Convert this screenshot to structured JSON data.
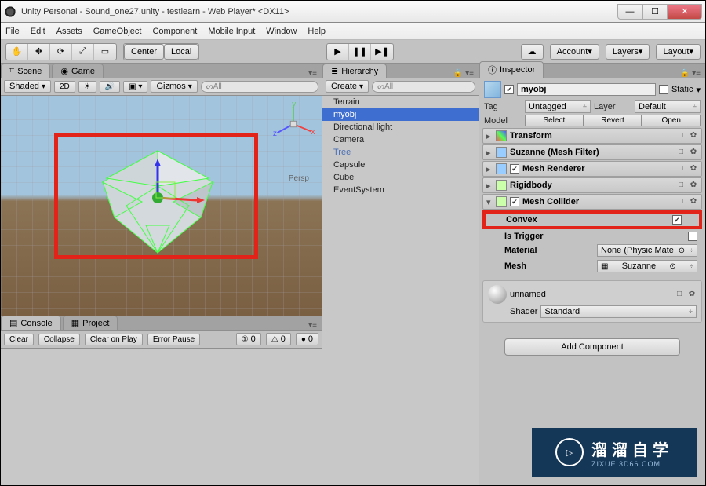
{
  "window": {
    "title": "Unity Personal - Sound_one27.unity - testlearn - Web Player* <DX11>"
  },
  "menus": [
    "File",
    "Edit",
    "Assets",
    "GameObject",
    "Component",
    "Mobile Input",
    "Window",
    "Help"
  ],
  "toolbar": {
    "center": "Center",
    "local": "Local",
    "account": "Account",
    "layers": "Layers",
    "layout": "Layout"
  },
  "scene": {
    "tab_scene": "Scene",
    "tab_game": "Game",
    "shading": "Shaded",
    "mode2d": "2D",
    "gizmos": "Gizmos",
    "search_placeholder": "All",
    "persp": "Persp"
  },
  "console": {
    "tab_console": "Console",
    "tab_project": "Project",
    "clear": "Clear",
    "collapse": "Collapse",
    "clear_on_play": "Clear on Play",
    "error_pause": "Error Pause",
    "count0": "0",
    "count1": "0",
    "count2": "0"
  },
  "hierarchy": {
    "tab": "Hierarchy",
    "create": "Create",
    "search_placeholder": "All",
    "items": [
      {
        "label": "Terrain",
        "blue": false,
        "sel": false
      },
      {
        "label": "myobj",
        "blue": false,
        "sel": true
      },
      {
        "label": "Directional light",
        "blue": false,
        "sel": false
      },
      {
        "label": "Camera",
        "blue": false,
        "sel": false
      },
      {
        "label": "Tree",
        "blue": true,
        "sel": false
      },
      {
        "label": "Capsule",
        "blue": false,
        "sel": false
      },
      {
        "label": "Cube",
        "blue": false,
        "sel": false
      },
      {
        "label": "EventSystem",
        "blue": false,
        "sel": false
      }
    ]
  },
  "inspector": {
    "tab": "Inspector",
    "obj_name": "myobj",
    "static": "Static",
    "tag_label": "Tag",
    "tag_value": "Untagged",
    "layer_label": "Layer",
    "layer_value": "Default",
    "model_label": "Model",
    "select": "Select",
    "revert": "Revert",
    "open": "Open",
    "components": [
      {
        "title": "Transform",
        "chk": false,
        "open": false
      },
      {
        "title": "Suzanne (Mesh Filter)",
        "chk": false,
        "open": false
      },
      {
        "title": "Mesh Renderer",
        "chk": true,
        "open": false
      },
      {
        "title": "Rigidbody",
        "chk": false,
        "open": false
      },
      {
        "title": "Mesh Collider",
        "chk": true,
        "open": true
      }
    ],
    "convex_label": "Convex",
    "is_trigger_label": "Is Trigger",
    "material_label": "Material",
    "material_value": "None (Physic Mate",
    "mesh_label": "Mesh",
    "mesh_value": "Suzanne",
    "mat_name": "unnamed",
    "shader_label": "Shader",
    "shader_value": "Standard",
    "add_component": "Add Component"
  },
  "watermark": {
    "main": "溜溜自学",
    "sub": "ZIXUE.3D66.COM"
  }
}
